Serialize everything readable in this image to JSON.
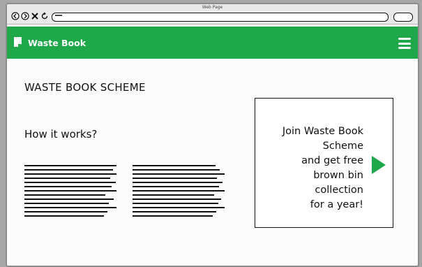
{
  "window": {
    "title": "Web Page"
  },
  "colors": {
    "accent": "#1fa84a",
    "background": "#a7a7a7"
  },
  "icons": {
    "back": "chevron-left-icon",
    "forward": "chevron-right-icon",
    "stop": "close-icon",
    "reload": "refresh-icon",
    "logo": "book-icon",
    "menu": "hamburger-menu-icon",
    "promo_arrow": "play-icon"
  },
  "header": {
    "brand": "Waste Book"
  },
  "main": {
    "title": "WASTE BOOK SCHEME",
    "subheading": "How it works?"
  },
  "promo": {
    "text": "Join Waste Book\nScheme\nand get free\nbrown bin\ncollection\nfor a year!"
  }
}
